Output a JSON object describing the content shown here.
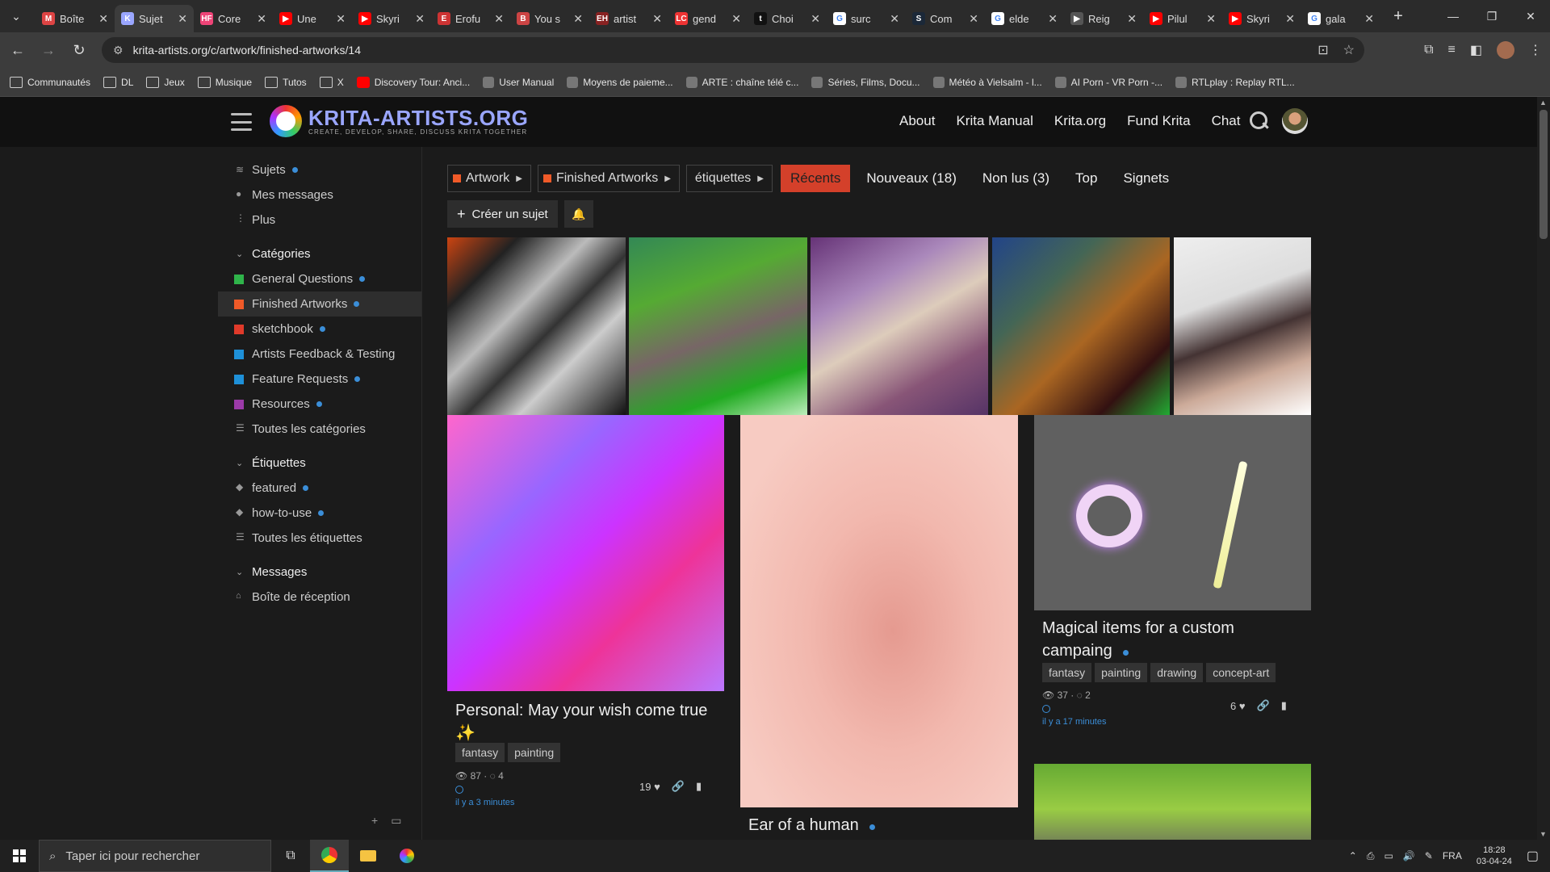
{
  "browser": {
    "tabs": [
      {
        "label": "Boîte",
        "fav_color": "#d44",
        "fav_glyph": "M",
        "active": false
      },
      {
        "label": "Sujet",
        "fav_color": "#9aa6ff",
        "fav_glyph": "K",
        "active": true
      },
      {
        "label": "Core",
        "fav_color": "#e47",
        "fav_glyph": "HF",
        "active": false
      },
      {
        "label": "Une",
        "fav_color": "#f00",
        "fav_glyph": "▶",
        "active": false
      },
      {
        "label": "Skyri",
        "fav_color": "#f00",
        "fav_glyph": "▶",
        "active": false
      },
      {
        "label": "Erofu",
        "fav_color": "#c33",
        "fav_glyph": "E",
        "active": false
      },
      {
        "label": "You s",
        "fav_color": "#c44",
        "fav_glyph": "B",
        "active": false
      },
      {
        "label": "artist",
        "fav_color": "#822",
        "fav_glyph": "EH",
        "active": false
      },
      {
        "label": "gend",
        "fav_color": "#e33",
        "fav_glyph": "LC",
        "active": false
      },
      {
        "label": "Choi",
        "fav_color": "#111",
        "fav_glyph": "t",
        "active": false
      },
      {
        "label": "surc",
        "fav_color": "#fff",
        "fav_glyph": "G",
        "active": false
      },
      {
        "label": "Com",
        "fav_color": "#1b2838",
        "fav_glyph": "S",
        "active": false
      },
      {
        "label": "elde",
        "fav_color": "#fff",
        "fav_glyph": "G",
        "active": false
      },
      {
        "label": "Reig",
        "fav_color": "#555",
        "fav_glyph": "▶",
        "active": false
      },
      {
        "label": "Pilul",
        "fav_color": "#f00",
        "fav_glyph": "▶",
        "active": false
      },
      {
        "label": "Skyri",
        "fav_color": "#f00",
        "fav_glyph": "▶",
        "active": false
      },
      {
        "label": "gala",
        "fav_color": "#fff",
        "fav_glyph": "G",
        "active": false
      }
    ],
    "url": "krita-artists.org/c/artwork/finished-artworks/14",
    "bookmarks": [
      {
        "label": "Communautés",
        "type": "folder"
      },
      {
        "label": "DL",
        "type": "folder"
      },
      {
        "label": "Jeux",
        "type": "folder"
      },
      {
        "label": "Musique",
        "type": "folder"
      },
      {
        "label": "Tutos",
        "type": "folder"
      },
      {
        "label": "X",
        "type": "folder"
      },
      {
        "label": "Discovery Tour: Anci...",
        "type": "youtube"
      },
      {
        "label": "User Manual",
        "type": "doc"
      },
      {
        "label": "Moyens de paieme...",
        "type": "site"
      },
      {
        "label": "ARTE : chaîne télé c...",
        "type": "site"
      },
      {
        "label": "Séries, Films, Docu...",
        "type": "site"
      },
      {
        "label": "Météo à Vielsalm - l...",
        "type": "site"
      },
      {
        "label": "AI Porn - VR Porn -...",
        "type": "site"
      },
      {
        "label": "RTLplay : Replay RTL...",
        "type": "site"
      }
    ]
  },
  "site": {
    "logo_title": "KRITA-ARTISTS.ORG",
    "logo_subtitle": "CREATE, DEVELOP, SHARE, DISCUSS KRITA TOGETHER",
    "nav": [
      "About",
      "Krita Manual",
      "Krita.org",
      "Fund Krita",
      "Chat"
    ]
  },
  "sidebar": {
    "top": [
      {
        "label": "Sujets",
        "dot": true
      },
      {
        "label": "Mes messages",
        "dot": false
      },
      {
        "label": "Plus",
        "dot": false
      }
    ],
    "categories_heading": "Catégories",
    "categories": [
      {
        "label": "General Questions",
        "color": "#2fb44a",
        "dot": true
      },
      {
        "label": "Finished Artworks",
        "color": "#f05a28",
        "dot": true,
        "selected": true
      },
      {
        "label": "sketchbook",
        "color": "#e03a2a",
        "dot": true
      },
      {
        "label": "Artists Feedback & Testing",
        "color": "#1e90d8",
        "dot": false
      },
      {
        "label": "Feature Requests",
        "color": "#1e90d8",
        "dot": true
      },
      {
        "label": "Resources",
        "color": "#9b3aa8",
        "dot": true
      },
      {
        "label": "Toutes les catégories",
        "color": "",
        "dot": false
      }
    ],
    "tags_heading": "Étiquettes",
    "tags": [
      {
        "label": "featured",
        "dot": true
      },
      {
        "label": "how-to-use",
        "dot": true
      },
      {
        "label": "Toutes les étiquettes",
        "dot": false
      }
    ],
    "messages_heading": "Messages",
    "messages": [
      {
        "label": "Boîte de réception"
      }
    ]
  },
  "filters": {
    "dropdowns": [
      "Artwork",
      "Finished Artworks",
      "étiquettes"
    ],
    "tabs": [
      "Récents",
      "Nouveaux (18)",
      "Non lus (3)",
      "Top",
      "Signets"
    ],
    "active_tab": "Récents",
    "create_label": "Créer un sujet"
  },
  "cards": [
    {
      "title": "Personal: May your wish come true ✨",
      "tags": [
        "fantasy",
        "painting"
      ],
      "views": "87",
      "replies": "4",
      "ago": "il y a 3 minutes",
      "likes": "19"
    },
    {
      "title": "Ear of a human",
      "tags": [],
      "views": "",
      "replies": "",
      "ago": "",
      "likes": ""
    },
    {
      "title": "Magical items for a custom campaing",
      "tags": [
        "fantasy",
        "painting",
        "drawing",
        "concept-art"
      ],
      "views": "37",
      "replies": "2",
      "ago": "il y a 17 minutes",
      "likes": "6"
    }
  ],
  "taskbar": {
    "search_placeholder": "Taper ici pour rechercher",
    "lang": "FRA",
    "time": "18:28",
    "date": "03-04-24"
  }
}
